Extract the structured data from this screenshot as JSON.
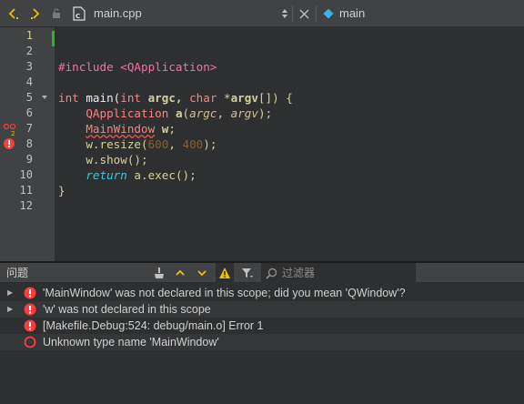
{
  "toolbar": {
    "filename": "main.cpp",
    "symbol": "main"
  },
  "editor": {
    "line_numbers": [
      "1",
      "2",
      "3",
      "4",
      "5",
      "6",
      "7",
      "8",
      "9",
      "10",
      "11",
      "12"
    ],
    "current_line": "1",
    "lines": {
      "l3": {
        "a": "#include <QApplication>"
      },
      "l5": {
        "a": "int",
        "b": " main(",
        "c": "int",
        "d": " argc, ",
        "e": "char",
        "f": " *",
        "g": "argv",
        "h": "[]) {"
      },
      "l6": {
        "a": "    ",
        "b": "QApplication",
        "c": " ",
        "d": "a",
        "e": "(",
        "f": "argc",
        "g": ", ",
        "h": "argv",
        "i": ");"
      },
      "l7": {
        "a": "    ",
        "b": "MainWindow",
        "c": " ",
        "d": "w",
        "e": ";"
      },
      "l8": {
        "a": "    w.",
        "b": "resize",
        "c": "(",
        "d": "600",
        "e": ", ",
        "f": "400",
        "g": ");"
      },
      "l9": {
        "a": "    w.",
        "b": "show",
        "c": "();"
      },
      "l10": {
        "a": "    ",
        "b": "return",
        "c": " a.",
        "d": "exec",
        "e": "();"
      },
      "l11": {
        "a": "}"
      }
    },
    "marker_count": "2"
  },
  "issues": {
    "title": "问题",
    "filter_placeholder": "过滤器",
    "items": [
      {
        "text": "'MainWindow' was not declared in this scope; did you mean 'QWindow'?",
        "severity": "error"
      },
      {
        "text": "'w' was not declared in this scope",
        "severity": "error"
      },
      {
        "text": "[Makefile.Debug:524: debug/main.o] Error 1",
        "severity": "error"
      },
      {
        "text": "Unknown type name 'MainWindow'",
        "severity": "error-outline"
      }
    ]
  },
  "colors": {
    "error": "#ff3b3b",
    "warning": "#f0c000",
    "current_line_bar": "#28b828",
    "symbol_icon": "#3eb2e8"
  }
}
